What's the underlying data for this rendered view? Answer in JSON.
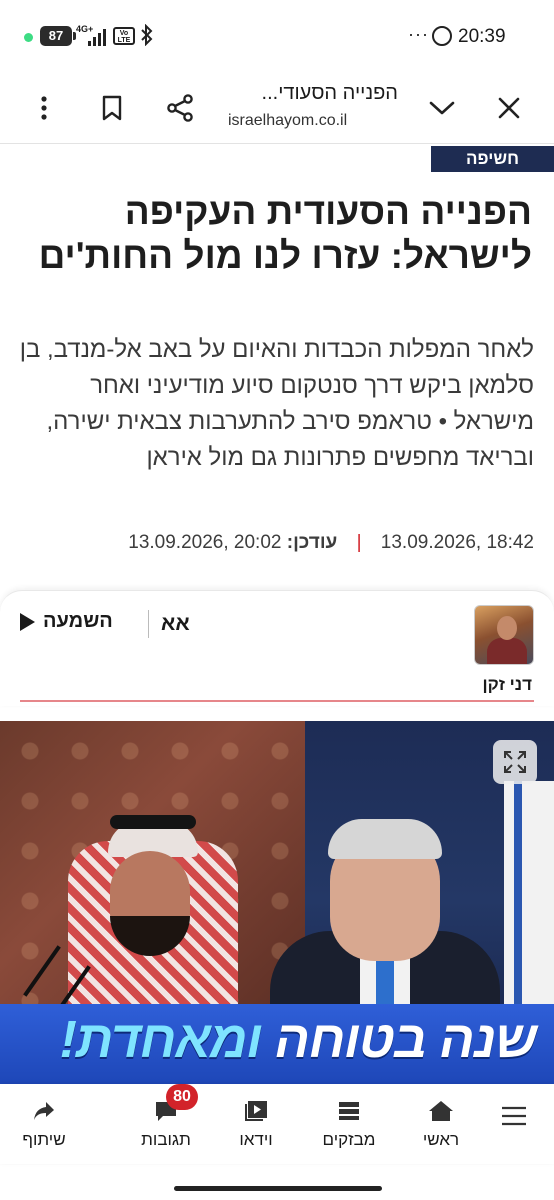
{
  "status_bar": {
    "battery": "87",
    "network": "4G+",
    "volte": "Vo LTE",
    "more": "···",
    "time": "20:39"
  },
  "browser": {
    "title": "הפנייה הסעודי...",
    "url": "israelhayom.co.il",
    "icons": [
      "close-icon",
      "chevron-down-icon",
      "share-icon",
      "bookmark-icon",
      "more-vertical-icon"
    ]
  },
  "article": {
    "category": "חשיפה",
    "headline": "הפנייה הסעודית העקיפה לישראל: עזרו לנו מול החות'ים",
    "subheadline": "לאחר המפלות הכבדות והאיום על באב אל-מנדב, בן סלמאן ביקש דרך סנטקום סיוע מודיעיני ואחר מישראל • טראמפ סירב להתערבות צבאית ישירה, ובריאד מחפשים פתרונות גם מול איראן",
    "published": "18:42 ,13.09.2026",
    "updated_label": "עודכן:",
    "updated": "20:02 ,13.09.2026",
    "separator": "|"
  },
  "author_card": {
    "author_name": "דני זקן",
    "listen_label": "השמעה",
    "font_toggle_label": "אא"
  },
  "hero": {
    "banner_text_main": "שנה בטוחה ",
    "banner_text_accent": "ומאחדת!"
  },
  "bottom_nav": {
    "items": [
      {
        "label": "ראשי",
        "icon": "home-icon"
      },
      {
        "label": "מבזקים",
        "icon": "news-flash-icon"
      },
      {
        "label": "וידאו",
        "icon": "video-icon"
      },
      {
        "label": "תגובות",
        "icon": "comments-icon"
      },
      {
        "label": "שיתוף",
        "icon": "share-arrow-icon"
      }
    ],
    "comments_badge": "80",
    "menu_icon": "hamburger-menu-icon"
  },
  "colors": {
    "tag_bg": "#1e2c52",
    "accent_red": "#d2232a",
    "banner_blue": "#2f5fd8",
    "banner_accent": "#7fe4ff"
  }
}
